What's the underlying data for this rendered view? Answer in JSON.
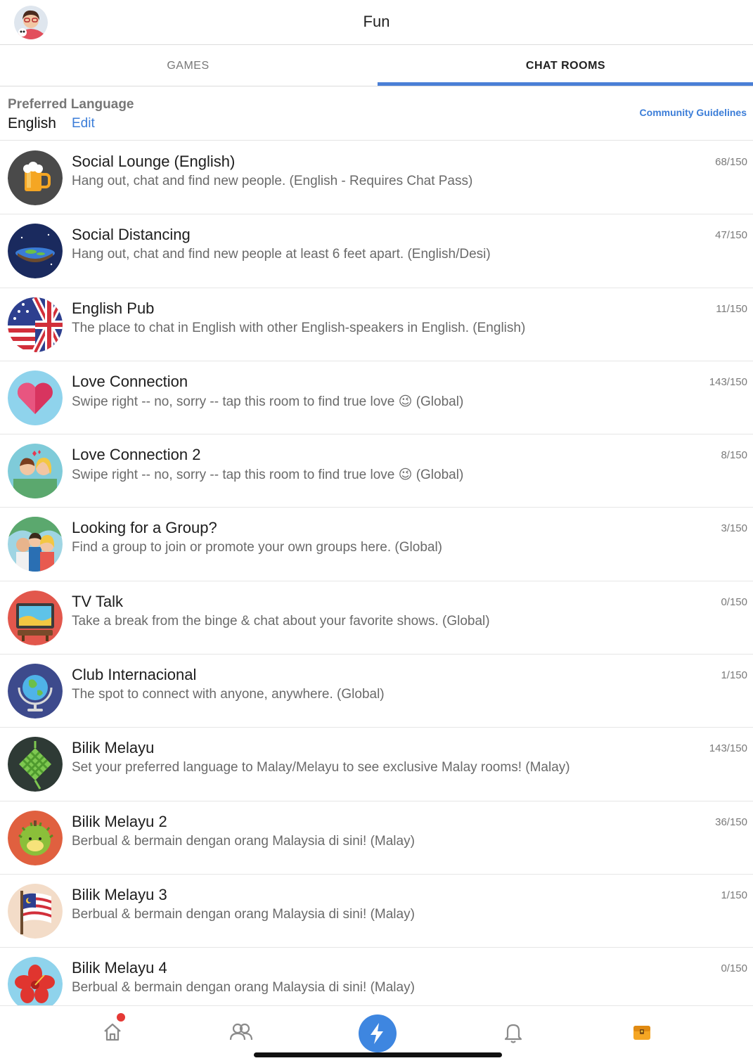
{
  "header": {
    "title": "Fun",
    "avatar_icon": "profile-avatar"
  },
  "tabs": [
    {
      "label": "GAMES",
      "active": false
    },
    {
      "label": "CHAT ROOMS",
      "active": true
    }
  ],
  "accent_color": "#4a7fd6",
  "language": {
    "label": "Preferred Language",
    "value": "English",
    "edit_label": "Edit",
    "guidelines_label": "Community Guidelines"
  },
  "rooms": [
    {
      "name": "Social Lounge (English)",
      "description": "Hang out, chat and find new people. (English - Requires Chat Pass)",
      "count": "68/150",
      "icon": "beer-mug-icon"
    },
    {
      "name": "Social Distancing",
      "description": "Hang out, chat and find new people at least 6 feet apart. (English/Desi)",
      "count": "47/150",
      "icon": "flat-earth-icon"
    },
    {
      "name": "English Pub",
      "description": "The place to chat in English with other English-speakers in English. (English)",
      "count": "11/150",
      "icon": "us-uk-flag-icon"
    },
    {
      "name": "Love Connection",
      "description": "Swipe right -- no, sorry -- tap this room to find true love 😉 (Global)",
      "count": "143/150",
      "icon": "heart-icon"
    },
    {
      "name": "Love Connection 2",
      "description": "Swipe right -- no, sorry -- tap this room to find true love 😉 (Global)",
      "count": "8/150",
      "icon": "couple-icon"
    },
    {
      "name": "Looking for a Group?",
      "description": "Find a group to join or promote your own groups here. (Global)",
      "count": "3/150",
      "icon": "group-icon"
    },
    {
      "name": "TV Talk",
      "description": "Take a break from the binge & chat about your favorite shows. (Global)",
      "count": "0/150",
      "icon": "tv-icon"
    },
    {
      "name": "Club Internacional",
      "description": "The spot to connect with anyone, anywhere. (Global)",
      "count": "1/150",
      "icon": "globe-icon"
    },
    {
      "name": "Bilik Melayu",
      "description": "Set your preferred language to Malay/Melayu to see exclusive Malay rooms! (Malay)",
      "count": "143/150",
      "icon": "ketupat-icon"
    },
    {
      "name": "Bilik Melayu 2",
      "description": "Berbual & bermain dengan orang Malaysia di sini! (Malay)",
      "count": "36/150",
      "icon": "durian-icon"
    },
    {
      "name": "Bilik Melayu 3",
      "description": "Berbual & bermain dengan orang Malaysia di sini! (Malay)",
      "count": "1/150",
      "icon": "malaysia-flag-icon"
    },
    {
      "name": "Bilik Melayu 4",
      "description": "Berbual & bermain dengan orang Malaysia di sini! (Malay)",
      "count": "0/150",
      "icon": "hibiscus-icon"
    }
  ],
  "bottom_nav": [
    {
      "icon": "home-icon",
      "has_notification": true
    },
    {
      "icon": "friends-icon"
    },
    {
      "icon": "lightning-icon",
      "active": true
    },
    {
      "icon": "bell-icon"
    },
    {
      "icon": "treasure-chest-icon"
    }
  ]
}
